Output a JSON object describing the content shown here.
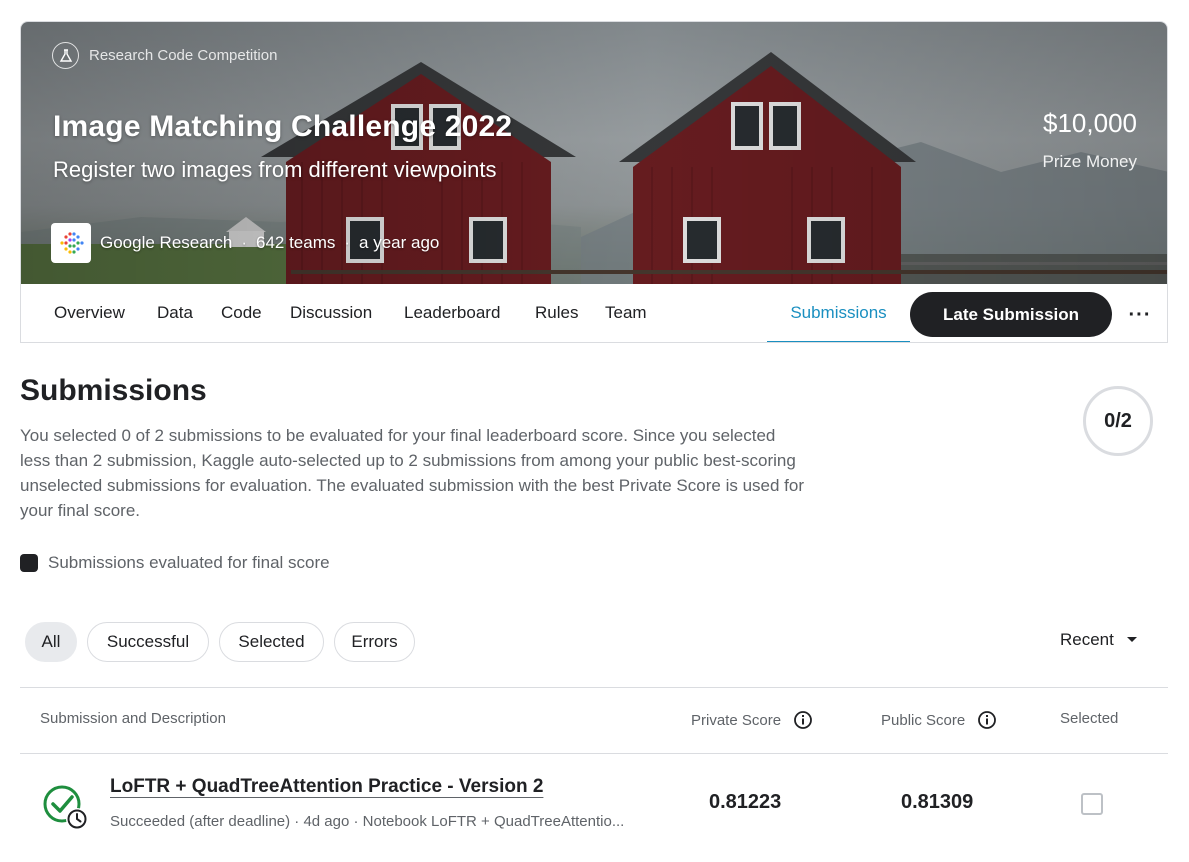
{
  "competition": {
    "type_label": "Research Code Competition",
    "title": "Image Matching Challenge 2022",
    "subtitle": "Register two images from different viewpoints",
    "prize_amount": "$10,000",
    "prize_label": "Prize Money",
    "host": "Google Research",
    "teams": "642 teams",
    "time": "a year ago",
    "separator": "·"
  },
  "tabs": [
    {
      "label": "Overview"
    },
    {
      "label": "Data"
    },
    {
      "label": "Code"
    },
    {
      "label": "Discussion"
    },
    {
      "label": "Leaderboard"
    },
    {
      "label": "Rules"
    },
    {
      "label": "Team"
    },
    {
      "label": "Submissions",
      "active": true
    }
  ],
  "late_submission_label": "Late Submission",
  "more_label": "···",
  "page": {
    "title": "Submissions",
    "description": "You selected 0 of 2 submissions to be evaluated for your final leaderboard score. Since you selected less than 2 submission, Kaggle auto-selected up to 2 submissions from among your public best-scoring unselected submissions for evaluation. The evaluated submission with the best Private Score is used for your final score.",
    "counter": "0/2",
    "legend": "Submissions evaluated for final score"
  },
  "filters": [
    {
      "label": "All",
      "active": true
    },
    {
      "label": "Successful"
    },
    {
      "label": "Selected"
    },
    {
      "label": "Errors"
    }
  ],
  "sort_label": "Recent",
  "table": {
    "headers": {
      "submission": "Submission and Description",
      "private": "Private Score",
      "public": "Public Score",
      "selected": "Selected"
    },
    "rows": [
      {
        "title": "LoFTR + QuadTreeAttention Practice - Version 2",
        "meta": "Succeeded (after deadline) · 4d ago · Notebook LoFTR + QuadTreeAttentio...",
        "private_score": "0.81223",
        "public_score": "0.81309",
        "selected": false,
        "status": "succeeded-late"
      }
    ]
  },
  "colors": {
    "accent": "#1a8fc0",
    "success": "#1e8e3e",
    "dark": "#202124",
    "muted": "#5f6368"
  }
}
